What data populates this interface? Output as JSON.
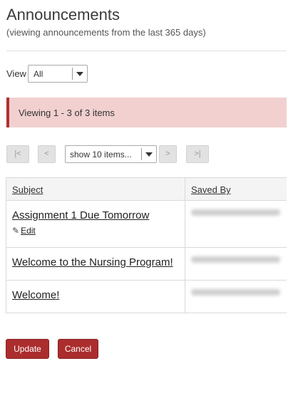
{
  "header": {
    "title": "Announcements",
    "subtitle": "(viewing announcements from the last 365 days)"
  },
  "view_filter": {
    "label": "View",
    "selected": "All"
  },
  "notice": {
    "text": "Viewing 1 - 3 of 3 items"
  },
  "pager": {
    "first": "|<",
    "prev": "<",
    "page_size": "show 10 items...",
    "next": ">",
    "last": ">|"
  },
  "table": {
    "columns": [
      "Subject",
      "Saved By"
    ],
    "rows": [
      {
        "subject": "Assignment 1 Due Tomorrow",
        "edit": "Edit"
      },
      {
        "subject": "Welcome to the Nursing Program!"
      },
      {
        "subject": "Welcome!"
      }
    ]
  },
  "actions": {
    "update": "Update",
    "cancel": "Cancel"
  },
  "icons": {
    "edit": "pencil-icon",
    "dropdown": "chevron-down-icon"
  },
  "colors": {
    "notice_bg": "#f2d0d0",
    "notice_border": "#b03030",
    "primary_button": "#ab2d2d"
  }
}
